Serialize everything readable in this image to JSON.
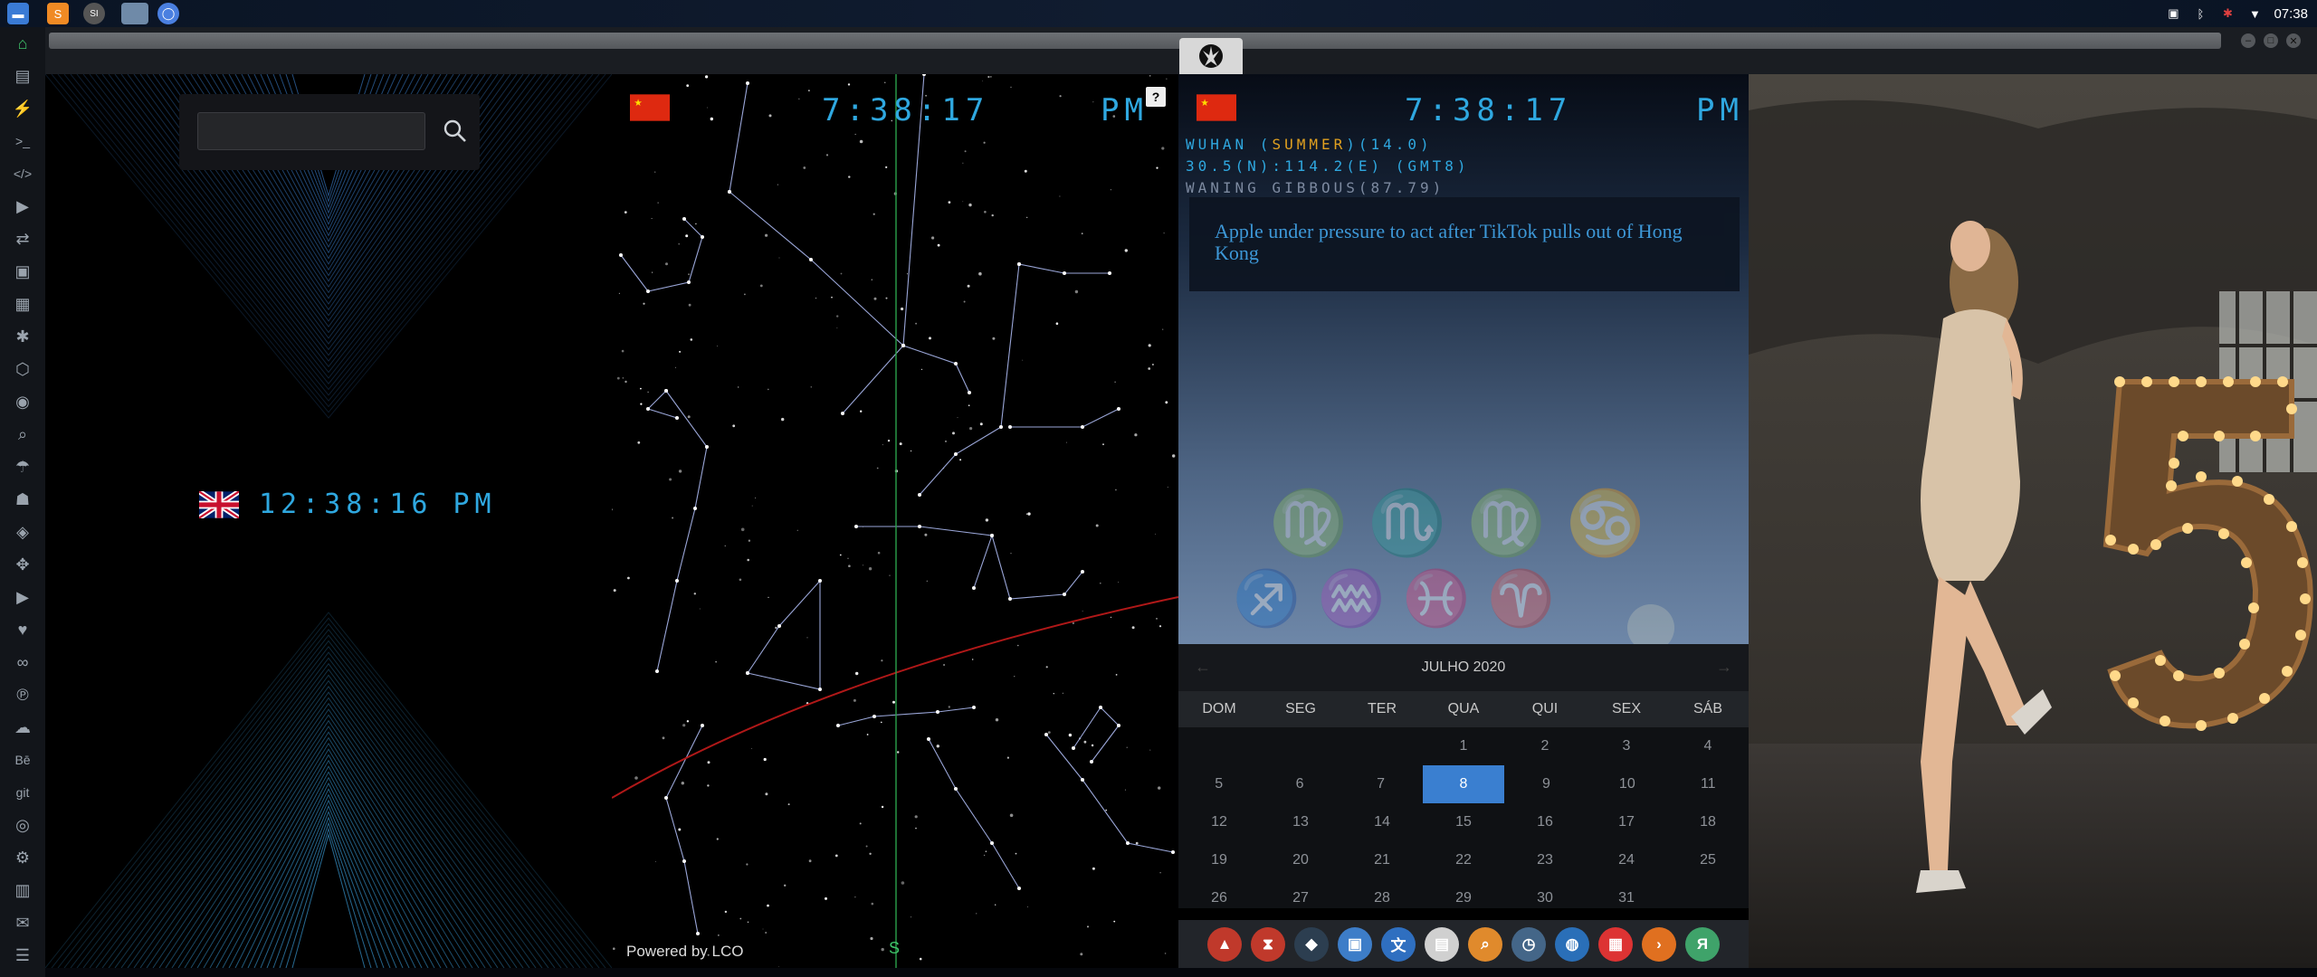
{
  "topbar": {
    "time": "07:38",
    "launchers": [
      {
        "icon": "file-manager-icon",
        "color": "#3a7bd5"
      },
      {
        "icon": "sublime-text-icon",
        "color": "#f08a24"
      },
      {
        "icon": "app-si-icon",
        "color": "#555"
      },
      {
        "icon": "window-thumbnail-icon",
        "color": "#6f8aa8"
      },
      {
        "icon": "chromium-icon",
        "color": "#4a7fe0"
      }
    ],
    "launcher_si_label": "SI"
  },
  "sidebar": {
    "items": [
      {
        "icon": "home-icon",
        "glyph": "⌂"
      },
      {
        "icon": "document-icon",
        "glyph": "▤"
      },
      {
        "icon": "lightning-icon",
        "glyph": "⚡"
      },
      {
        "icon": "terminal-icon",
        "glyph": ">_"
      },
      {
        "icon": "code-icon",
        "glyph": "</>"
      },
      {
        "icon": "play-icon",
        "glyph": "▶"
      },
      {
        "icon": "translate-icon",
        "glyph": "⇄"
      },
      {
        "icon": "image-icon",
        "glyph": "▣"
      },
      {
        "icon": "news-icon",
        "glyph": "▦"
      },
      {
        "icon": "settings-icon",
        "glyph": "✱"
      },
      {
        "icon": "package-icon",
        "glyph": "⬡"
      },
      {
        "icon": "globe-icon",
        "glyph": "◉"
      },
      {
        "icon": "search-icon",
        "glyph": "⌕"
      },
      {
        "icon": "umbrella-icon",
        "glyph": "☂"
      },
      {
        "icon": "contact-icon",
        "glyph": "☗"
      },
      {
        "icon": "tag-icon",
        "glyph": "◈"
      },
      {
        "icon": "expand-icon",
        "glyph": "✥"
      },
      {
        "icon": "youtube-icon",
        "glyph": "▶"
      },
      {
        "icon": "heart-icon",
        "glyph": "♥"
      },
      {
        "icon": "infinity-icon",
        "glyph": "∞"
      },
      {
        "icon": "pinterest-icon",
        "glyph": "℗"
      },
      {
        "icon": "cloud-icon",
        "glyph": "☁"
      },
      {
        "icon": "behance-icon",
        "glyph": "Bē"
      },
      {
        "icon": "git-icon",
        "glyph": "git"
      },
      {
        "icon": "github-icon",
        "glyph": "◎"
      },
      {
        "icon": "network-icon",
        "glyph": "⚙"
      },
      {
        "icon": "map-icon",
        "glyph": "▥"
      },
      {
        "icon": "mail-icon",
        "glyph": "✉"
      },
      {
        "icon": "storage-icon",
        "glyph": "☰"
      }
    ]
  },
  "search": {
    "value": "",
    "placeholder": ""
  },
  "uk_clock": {
    "time": "12:38:16",
    "ampm": "PM"
  },
  "sky_panel": {
    "time": "7:38:17",
    "ampm": "PM",
    "help_label": "?",
    "powered_by": "Powered by LCO",
    "compass": "S"
  },
  "weather_panel": {
    "time": "7:38:17",
    "ampm": "PM",
    "city": "WUHAN",
    "season": "SUMMER",
    "temp": "(14.0)",
    "coords": "30.5(N):114.2(E) (GMT8)",
    "moon": "WANING GIBBOUS(87.79)",
    "headline": "Apple under pressure to act after TikTok pulls out of Hong Kong"
  },
  "calendar": {
    "month_label": "JULHO 2020",
    "prev": "←",
    "next": "→",
    "days": [
      "DOM",
      "SEG",
      "TER",
      "QUA",
      "QUI",
      "SEX",
      "SÁB"
    ],
    "weeks": [
      [
        "",
        "",
        "",
        "1",
        "2",
        "3",
        "4"
      ],
      [
        "5",
        "6",
        "7",
        "8",
        "9",
        "10",
        "11"
      ],
      [
        "12",
        "13",
        "14",
        "15",
        "16",
        "17",
        "18"
      ],
      [
        "19",
        "20",
        "21",
        "22",
        "23",
        "24",
        "25"
      ],
      [
        "26",
        "27",
        "28",
        "29",
        "30",
        "31",
        ""
      ]
    ],
    "today": "8",
    "accent": "#3a7fd0"
  },
  "dock": {
    "apps": [
      {
        "icon": "vector-app-icon",
        "color": "#c0392b",
        "glyph": "▲"
      },
      {
        "icon": "timer-app-icon",
        "color": "#c0392b",
        "glyph": "⧗"
      },
      {
        "icon": "gpu-app-icon",
        "color": "#2c3e50",
        "glyph": "◆"
      },
      {
        "icon": "preview-app-icon",
        "color": "#3d7dc8",
        "glyph": "▣"
      },
      {
        "icon": "translate-app-icon",
        "color": "#2f6fc0",
        "glyph": "文"
      },
      {
        "icon": "news-app-icon",
        "color": "#d0d0d0",
        "glyph": "▤"
      },
      {
        "icon": "finder-app-icon",
        "color": "#e08a2c",
        "glyph": "⌕"
      },
      {
        "icon": "clock-app-icon",
        "color": "#446688",
        "glyph": "◷"
      },
      {
        "icon": "browser-app-icon",
        "color": "#2a6fb8",
        "glyph": "◍"
      },
      {
        "icon": "calendar-app-icon",
        "color": "#d33",
        "glyph": "▦"
      },
      {
        "icon": "terminal-app-icon",
        "color": "#e07020",
        "glyph": "›"
      },
      {
        "icon": "yandex-app-icon",
        "color": "#3fa36a",
        "glyph": "Я"
      }
    ]
  }
}
